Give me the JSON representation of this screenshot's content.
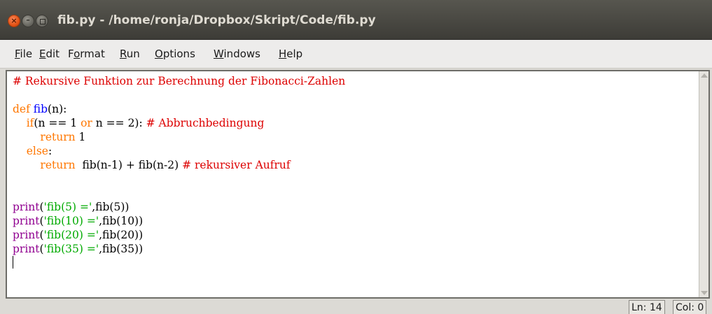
{
  "window": {
    "title": "fib.py - /home/ronja/Dropbox/Skript/Code/fib.py"
  },
  "menu": {
    "items": [
      {
        "underline": "F",
        "rest": "ile"
      },
      {
        "underline": "E",
        "rest": "dit"
      },
      {
        "pre": "F",
        "underline": "o",
        "rest": "rmat"
      },
      {
        "underline": "R",
        "rest": "un"
      },
      {
        "underline": "O",
        "rest": "ptions"
      },
      {
        "underline": "W",
        "rest": "indows"
      },
      {
        "underline": "H",
        "rest": "elp"
      }
    ]
  },
  "editor": {
    "lines": [
      [
        {
          "t": "# Rekursive Funktion zur Berechnung der Fibonacci-Zahlen",
          "c": "cm"
        }
      ],
      [],
      [
        {
          "t": "def",
          "c": "kw"
        },
        {
          "t": " ",
          "c": "plain"
        },
        {
          "t": "fib",
          "c": "def"
        },
        {
          "t": "(n):",
          "c": "plain"
        }
      ],
      [
        {
          "t": "    ",
          "c": "plain"
        },
        {
          "t": "if",
          "c": "kw"
        },
        {
          "t": "(n == 1 ",
          "c": "plain"
        },
        {
          "t": "or",
          "c": "kw"
        },
        {
          "t": " n == 2): ",
          "c": "plain"
        },
        {
          "t": "# Abbruchbedingung",
          "c": "cm"
        }
      ],
      [
        {
          "t": "        ",
          "c": "plain"
        },
        {
          "t": "return",
          "c": "kw"
        },
        {
          "t": " 1",
          "c": "plain"
        }
      ],
      [
        {
          "t": "    ",
          "c": "plain"
        },
        {
          "t": "else",
          "c": "kw"
        },
        {
          "t": ":",
          "c": "plain"
        }
      ],
      [
        {
          "t": "        ",
          "c": "plain"
        },
        {
          "t": "return",
          "c": "kw"
        },
        {
          "t": "  fib(n-1) + fib(n-2) ",
          "c": "plain"
        },
        {
          "t": "# rekursiver Aufruf",
          "c": "cm"
        }
      ],
      [],
      [],
      [
        {
          "t": "print",
          "c": "bi"
        },
        {
          "t": "(",
          "c": "plain"
        },
        {
          "t": "'fib(5) ='",
          "c": "str"
        },
        {
          "t": ",fib(5))",
          "c": "plain"
        }
      ],
      [
        {
          "t": "print",
          "c": "bi"
        },
        {
          "t": "(",
          "c": "plain"
        },
        {
          "t": "'fib(10) ='",
          "c": "str"
        },
        {
          "t": ",fib(10))",
          "c": "plain"
        }
      ],
      [
        {
          "t": "print",
          "c": "bi"
        },
        {
          "t": "(",
          "c": "plain"
        },
        {
          "t": "'fib(20) ='",
          "c": "str"
        },
        {
          "t": ",fib(20))",
          "c": "plain"
        }
      ],
      [
        {
          "t": "print",
          "c": "bi"
        },
        {
          "t": "(",
          "c": "plain"
        },
        {
          "t": "'fib(35) ='",
          "c": "str"
        },
        {
          "t": ",fib(35))",
          "c": "plain"
        }
      ],
      []
    ],
    "syntax_colors": {
      "keyword": "#ff7700",
      "builtin": "#900090",
      "definition": "#0000ff",
      "string": "#00aa00",
      "comment": "#dd0000"
    }
  },
  "status": {
    "line": "Ln: 14",
    "col": "Col: 0"
  }
}
